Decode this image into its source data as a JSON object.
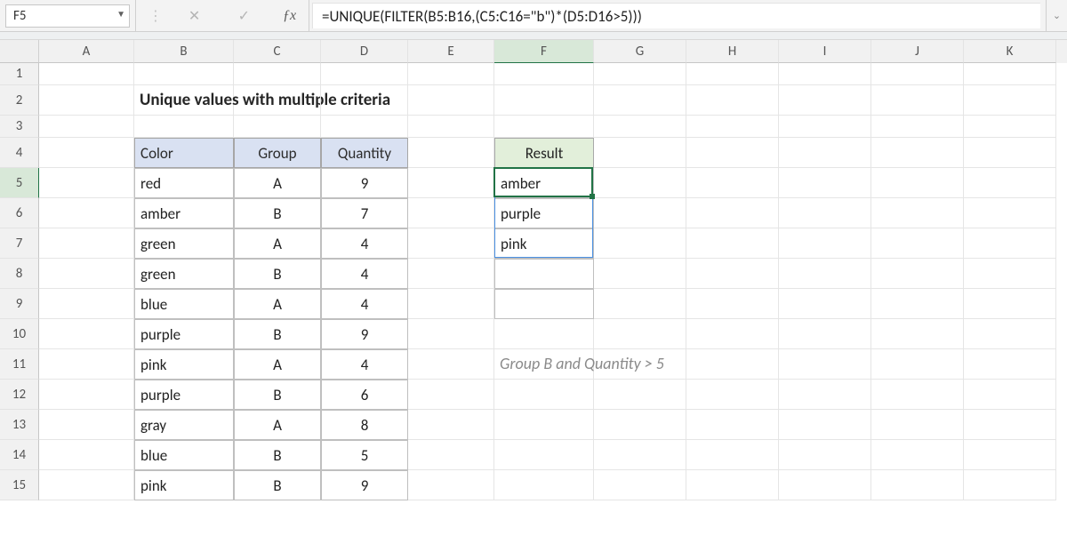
{
  "namebox": {
    "value": "F5"
  },
  "formula": {
    "value": "=UNIQUE(FILTER(B5:B16,(C5:C16=\"b\")*(D5:D16>5)))"
  },
  "title": "Unique values with multiple criteria",
  "note": "Group B and Quantity > 5",
  "columns": [
    "A",
    "B",
    "C",
    "D",
    "E",
    "F",
    "G",
    "H",
    "I",
    "J",
    "K"
  ],
  "colWidths": {
    "A": 107,
    "B": 112,
    "C": 98,
    "D": 98,
    "E": 97,
    "F": 112,
    "G": 104,
    "H": 104,
    "I": 104,
    "J": 104,
    "K": 104
  },
  "rowLabels": [
    "1",
    "2",
    "3",
    "4",
    "5",
    "6",
    "7",
    "8",
    "9",
    "10",
    "11",
    "12",
    "13",
    "14",
    "15"
  ],
  "selectedCol": "F",
  "selectedRow": "5",
  "table": {
    "headers": {
      "color": "Color",
      "group": "Group",
      "qty": "Quantity"
    },
    "rows": [
      {
        "color": "red",
        "group": "A",
        "qty": "9"
      },
      {
        "color": "amber",
        "group": "B",
        "qty": "7"
      },
      {
        "color": "green",
        "group": "A",
        "qty": "4"
      },
      {
        "color": "green",
        "group": "B",
        "qty": "4"
      },
      {
        "color": "blue",
        "group": "A",
        "qty": "4"
      },
      {
        "color": "purple",
        "group": "B",
        "qty": "9"
      },
      {
        "color": "pink",
        "group": "A",
        "qty": "4"
      },
      {
        "color": "purple",
        "group": "B",
        "qty": "6"
      },
      {
        "color": "gray",
        "group": "A",
        "qty": "8"
      },
      {
        "color": "blue",
        "group": "B",
        "qty": "5"
      },
      {
        "color": "pink",
        "group": "B",
        "qty": "9"
      }
    ]
  },
  "result": {
    "header": "Result",
    "values": [
      "amber",
      "purple",
      "pink"
    ],
    "emptyRows": 2
  },
  "activeCell": {
    "col": "F",
    "row": 5
  },
  "spillRange": {
    "col": "F",
    "startRow": 5,
    "endRow": 7
  }
}
